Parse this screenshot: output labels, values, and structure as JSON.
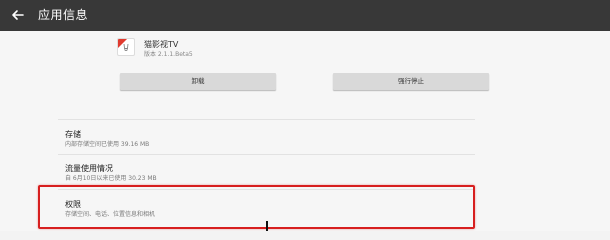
{
  "appbar": {
    "title": "应用信息",
    "back_icon": "arrow-left-icon"
  },
  "app": {
    "name": "猫影视TV",
    "version": "版本 2.1.1.Beta5",
    "icon": "app-icon"
  },
  "actions": {
    "uninstall_label": "卸载",
    "force_stop_label": "强行停止"
  },
  "sections": {
    "storage": {
      "title": "存储",
      "subtitle": "内部存储空间已使用 39.16 MB"
    },
    "data_usage": {
      "title": "流量使用情况",
      "subtitle": "自 6月10日以来已使用 30.23 MB"
    },
    "permissions": {
      "title": "权限",
      "subtitle": "存储空间、电话、位置信息和相机"
    }
  },
  "colors": {
    "appbar": "#383838",
    "highlight": "#d71f1f",
    "button": "#d9d9d9"
  }
}
